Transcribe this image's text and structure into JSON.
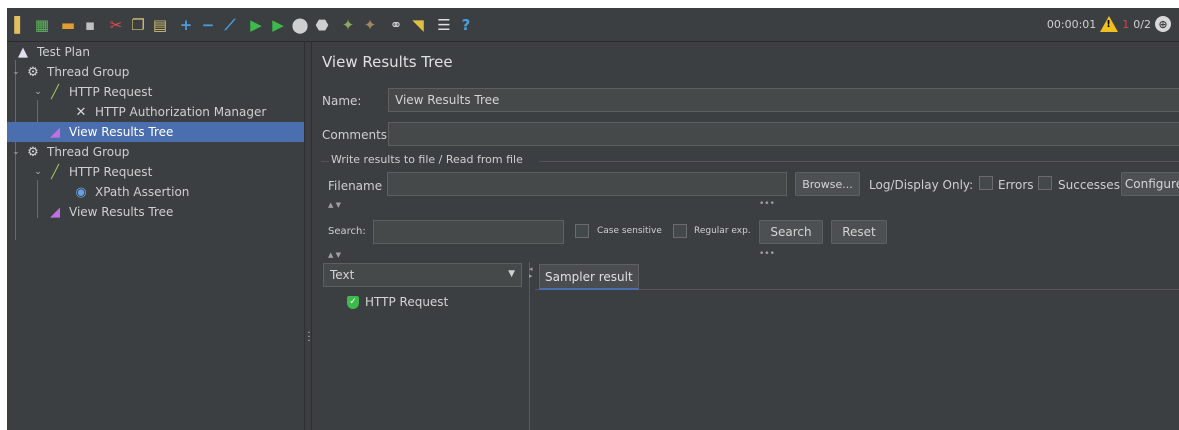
{
  "toolbar": {
    "icons": [
      {
        "name": "new-test-plan-icon",
        "glyph": "▌",
        "color": "#e0c060"
      },
      {
        "name": "templates-icon",
        "glyph": "▦",
        "color": "#5cb85c"
      },
      {
        "name": "open-icon",
        "glyph": "▬",
        "color": "#e0a030"
      },
      {
        "name": "save-icon",
        "glyph": "▪",
        "color": "#c0c0c0"
      },
      {
        "name": "cut-icon",
        "glyph": "✂",
        "color": "#e05050"
      },
      {
        "name": "copy-icon",
        "glyph": "❐",
        "color": "#d0c070"
      },
      {
        "name": "paste-icon",
        "glyph": "▤",
        "color": "#d0c070"
      },
      {
        "name": "expand-all-icon",
        "glyph": "+",
        "color": "#4a9edd"
      },
      {
        "name": "collapse-all-icon",
        "glyph": "−",
        "color": "#4a9edd"
      },
      {
        "name": "toggle-icon",
        "glyph": "⟋",
        "color": "#4a9edd"
      },
      {
        "name": "start-icon",
        "glyph": "▶",
        "color": "#3cba4c"
      },
      {
        "name": "start-no-timers-icon",
        "glyph": "▶",
        "color": "#3cba4c"
      },
      {
        "name": "stop-icon",
        "glyph": "⬤",
        "color": "#cfcfcf"
      },
      {
        "name": "shutdown-icon",
        "glyph": "⬣",
        "color": "#cfcfcf"
      },
      {
        "name": "clear-icon",
        "glyph": "✦",
        "color": "#8aa860"
      },
      {
        "name": "clear-all-icon",
        "glyph": "✦",
        "color": "#a08860"
      },
      {
        "name": "search-icon",
        "glyph": "⚭",
        "color": "#d0d0d0"
      },
      {
        "name": "reset-search-icon",
        "glyph": "◥",
        "color": "#e0c040"
      },
      {
        "name": "function-helper-icon",
        "glyph": "☰",
        "color": "#e0e0e0"
      },
      {
        "name": "help-icon",
        "glyph": "?",
        "color": "#4a9edd"
      }
    ],
    "timer": "00:00:01",
    "warning_icon": "warning-icon",
    "error_count": "1",
    "threads": "0/2"
  },
  "tree": [
    {
      "label": "Test Plan",
      "icon": "test-plan-icon",
      "glyph": "▲",
      "color": "#e0e0f0",
      "chevron": ""
    },
    {
      "label": "Thread Group",
      "icon": "gear-icon",
      "glyph": "⚙",
      "color": "#d8d8d8",
      "chevron": "⌄"
    },
    {
      "label": "HTTP Request",
      "icon": "pipette-icon",
      "glyph": "╱",
      "color": "#9acd5a",
      "chevron": "⌄"
    },
    {
      "label": "HTTP Authorization Manager",
      "icon": "tools-icon",
      "glyph": "✕",
      "color": "#d8d8d8",
      "chevron": ""
    },
    {
      "label": "View Results Tree",
      "icon": "chart-icon",
      "glyph": "◢",
      "color": "#c070e0",
      "chevron": ""
    },
    {
      "label": "Thread Group",
      "icon": "gear-icon",
      "glyph": "⚙",
      "color": "#d8d8d8",
      "chevron": "⌄"
    },
    {
      "label": "HTTP Request",
      "icon": "pipette-icon",
      "glyph": "╱",
      "color": "#9acd5a",
      "chevron": "⌄"
    },
    {
      "label": "XPath Assertion",
      "icon": "assertion-icon",
      "glyph": "◉",
      "color": "#6aa0e0",
      "chevron": ""
    },
    {
      "label": "View Results Tree",
      "icon": "chart-icon",
      "glyph": "◢",
      "color": "#c070e0",
      "chevron": ""
    }
  ],
  "panel": {
    "title": "View Results Tree",
    "name_label": "Name:",
    "name_value": "View Results Tree",
    "comments_label": "Comments:",
    "comments_value": "",
    "file_group_title": "Write results to file / Read from file",
    "filename_label": "Filename",
    "filename_value": "",
    "browse_label": "Browse...",
    "log_display_label": "Log/Display Only:",
    "errors_label": "Errors",
    "successes_label": "Successes",
    "configure_label": "Configure",
    "search_label": "Search:",
    "search_value": "",
    "case_sensitive_label": "Case sensitive",
    "regular_exp_label": "Regular exp.",
    "search_button": "Search",
    "reset_button": "Reset",
    "renderer_value": "Text",
    "results": [
      {
        "label": "HTTP Request",
        "icon": "success-shield-icon"
      }
    ],
    "tab_label": "Sampler result"
  }
}
